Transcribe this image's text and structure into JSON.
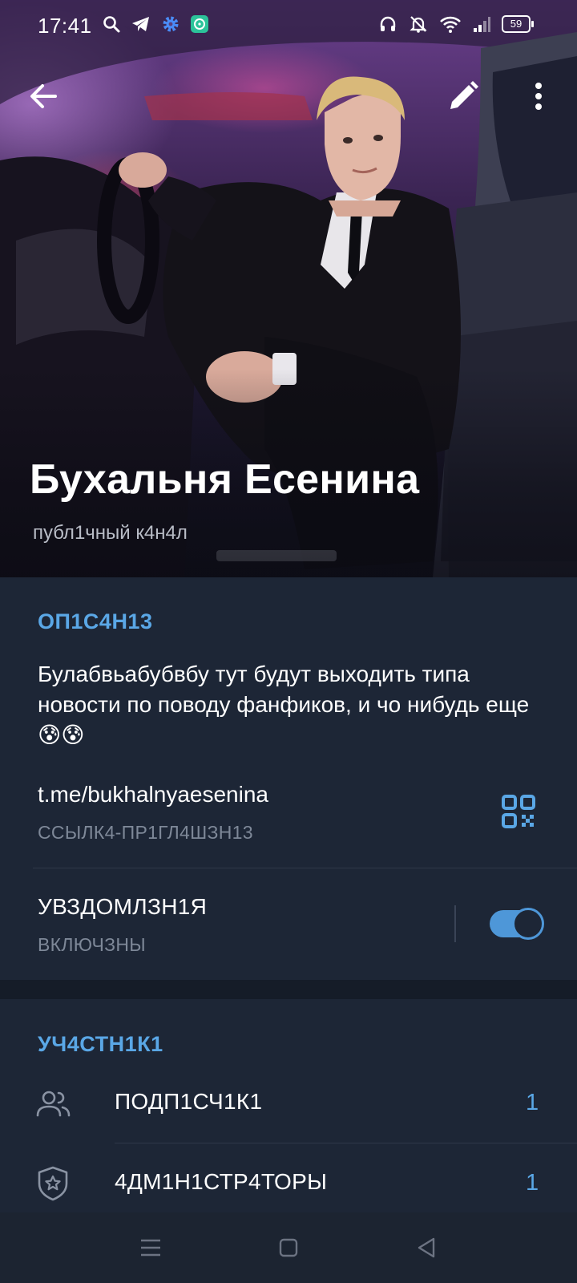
{
  "status_bar": {
    "time": "17:41",
    "battery": "59",
    "left_icons": [
      "search-icon",
      "telegram-icon",
      "settings-icon",
      "chat-app-icon"
    ],
    "right_icons": [
      "headset-icon",
      "mute-bell-icon",
      "wifi-icon",
      "signal-icon",
      "battery-icon"
    ]
  },
  "header": {
    "title": "Бухальня Есенина",
    "subtitle": "публ1чный к4н4л",
    "back_icon": "arrow-left-icon",
    "edit_icon": "pencil-icon",
    "more_icon": "more-vertical-icon"
  },
  "info": {
    "section_title": "ОП1С4Н13",
    "description": "Булабвьабубвбу тут будут выходить типа новости по поводу фанфиков, и чо нибудь еще😰😰",
    "link": "t.me/bukhalnyaesenina",
    "link_caption": "ССЫЛК4-ПР1ГЛ4ШЗН13",
    "notifications_label": "УВЗДОМЛЗН1Я",
    "notifications_status": "ВКЛЮЧЗНЫ",
    "notifications_on": true
  },
  "members": {
    "section_title": "УЧ4СТН1К1",
    "rows": [
      {
        "label": "ПОДП1СЧ1К1",
        "count": "1",
        "icon": "users-icon"
      },
      {
        "label": "4ДМ1Н1СТР4ТОРЫ",
        "count": "1",
        "icon": "shield-star-icon"
      }
    ]
  },
  "colors": {
    "accent": "#5aa7e6",
    "toggle": "#4e97d8",
    "background": "#1d2636"
  },
  "navbar": {
    "icons": [
      "menu-icon",
      "home-square-icon",
      "back-triangle-icon"
    ]
  }
}
